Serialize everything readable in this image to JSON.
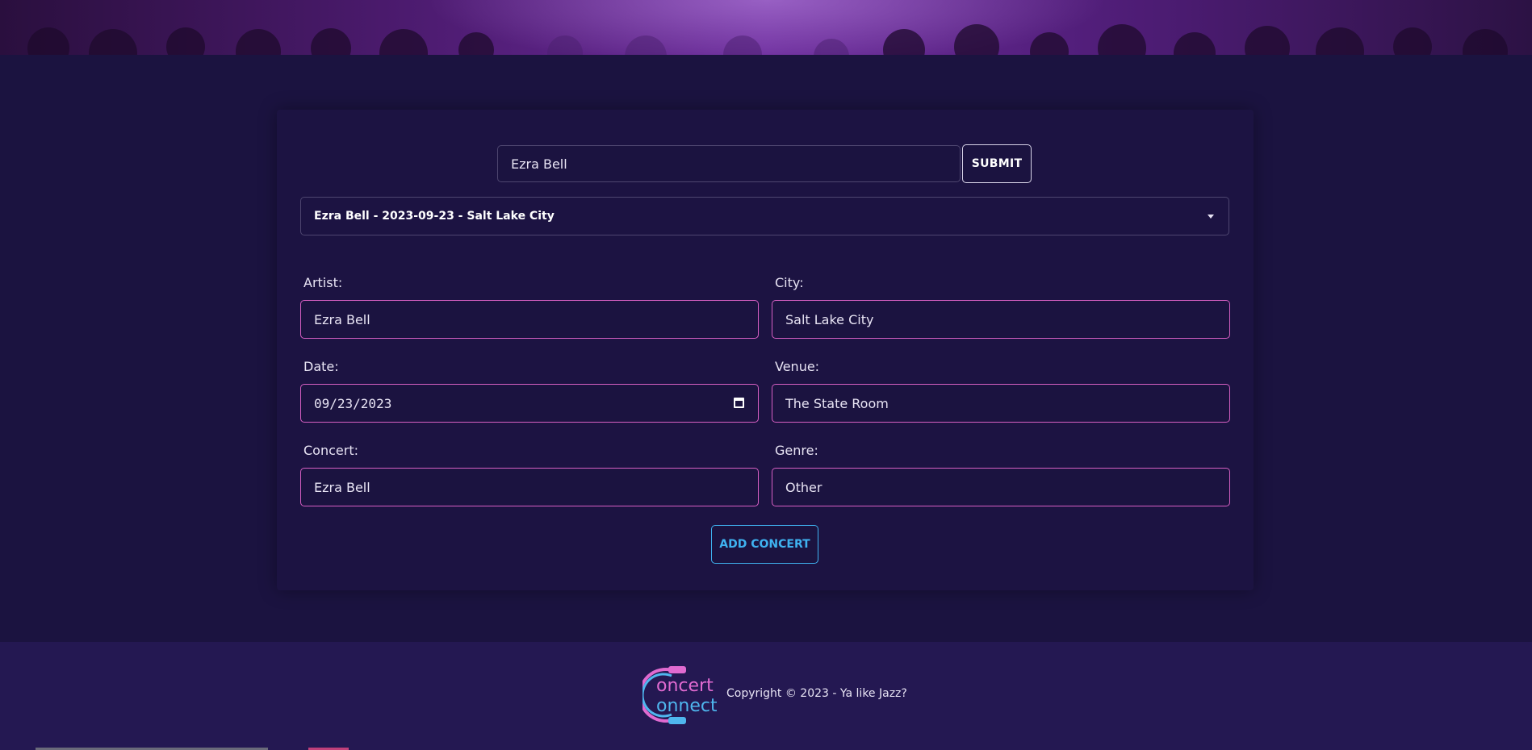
{
  "search": {
    "value": "Ezra Bell",
    "submit_label": "SUBMIT"
  },
  "results_select": {
    "selected": "Ezra Bell - 2023-09-23 - Salt Lake City"
  },
  "form": {
    "artist": {
      "label": "Artist:",
      "value": "Ezra Bell"
    },
    "city": {
      "label": "City:",
      "value": "Salt Lake City"
    },
    "date": {
      "label": "Date:",
      "value": "09/23/2023"
    },
    "venue": {
      "label": "Venue:",
      "value": "The State Room"
    },
    "concert": {
      "label": "Concert:",
      "value": "Ezra Bell"
    },
    "genre": {
      "label": "Genre:",
      "value": "Other"
    },
    "add_label": "ADD CONCERT"
  },
  "footer": {
    "logo_text": "ConcertConnect",
    "copyright": "Copyright © 2023 - Ya like Jazz?"
  },
  "colors": {
    "background": "#1b1340",
    "footer": "#241852",
    "field_border": "#d65fc3",
    "accent_blue": "#3fb2f0"
  },
  "icons": {
    "select_caret": "caret-down-icon",
    "calendar": "calendar-icon"
  }
}
